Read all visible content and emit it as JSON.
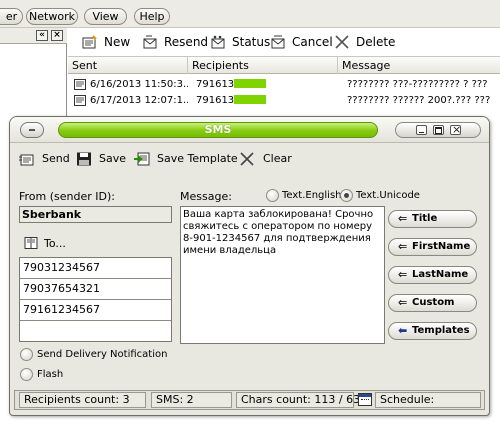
{
  "menu": [
    {
      "label": "er"
    },
    {
      "label": "Network"
    },
    {
      "label": "View"
    },
    {
      "label": "Help"
    }
  ],
  "main_toolbar": {
    "new": "New",
    "resend": "Resend",
    "status": "Status",
    "cancel": "Cancel",
    "delete": "Delete"
  },
  "grid": {
    "columns": [
      "Sent",
      "Recipients",
      "Message"
    ],
    "rows": [
      {
        "sent": "6/16/2013 11:50:3...",
        "recipient": "791613",
        "message": "???????? ???-????????? ? ???"
      },
      {
        "sent": "6/17/2013 12:07:1...",
        "recipient": "791613",
        "message": "???????? ?????? 200?.??? ???"
      }
    ]
  },
  "dialog": {
    "title": "SMS",
    "toolbar": {
      "send": "Send",
      "save": "Save",
      "save_template": "Save Template",
      "clear": "Clear"
    },
    "from_label": "From (sender ID):",
    "sender_id": "Sberbank",
    "to_label": "To...",
    "recipients": [
      "79031234567",
      "79037654321",
      "79161234567",
      ""
    ],
    "message_label": "Message:",
    "encoding": {
      "english": "Text.English",
      "unicode": "Text.Unicode",
      "selected": "unicode"
    },
    "message_text": "Ваша карта заблокирована! Срочно свяжитесь с оператором по номеру 8-901-1234567 для подтверждения имени владельца",
    "insert_buttons": [
      "Title",
      "FirstName",
      "LastName",
      "Custom",
      "Templates"
    ],
    "send_delivery_notification": "Send Delivery Notification",
    "flash": "Flash",
    "status": {
      "recipients_count": "Recipients count: 3",
      "sms": "SMS: 2",
      "chars_count": "Chars count: 113 / 63",
      "schedule": "Schedule:"
    },
    "colors": {
      "title_green": "#86cb12",
      "recipient_highlight": "#7fd400"
    }
  }
}
